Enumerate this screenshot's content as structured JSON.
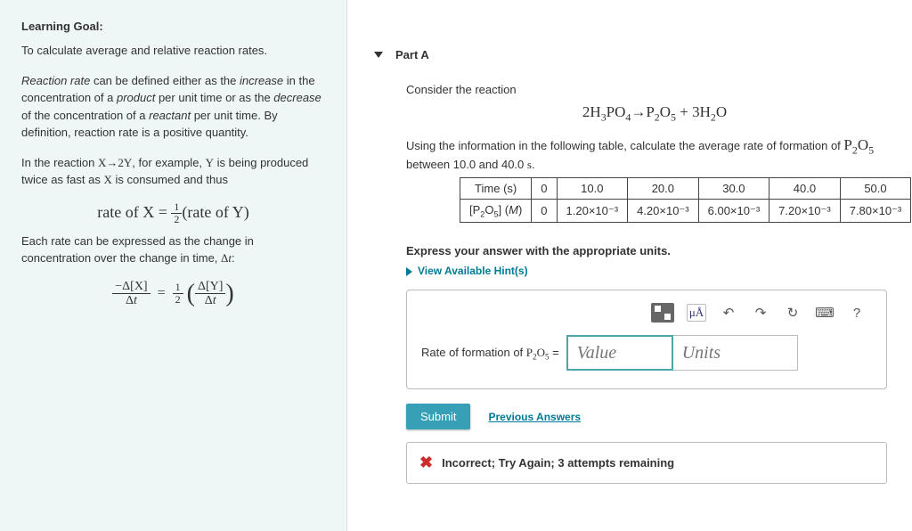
{
  "sidebar": {
    "heading": "Learning Goal:",
    "intro": "To calculate average and relative reaction rates.",
    "para1_a": "Reaction rate",
    "para1_b": " can be defined either as the ",
    "para1_c": "increase",
    "para1_d": " in the concentration of a ",
    "para1_e": "product",
    "para1_f": " per unit time or as the ",
    "para1_g": "decrease",
    "para1_h": " of the concentration of a ",
    "para1_i": "reactant",
    "para1_j": " per unit time. By definition, reaction rate is a positive quantity.",
    "para2_a": "In the reaction ",
    "para2_b": ", for example, ",
    "para2_c": " is being produced twice as fast as ",
    "para2_d": " is consumed and thus",
    "rate_eq_left": "rate of X",
    "rate_eq_right": "(rate of Y)",
    "para3": "Each rate can be expressed as the change in concentration over the change in time, "
  },
  "main": {
    "part_label": "Part A",
    "consider": "Consider the reaction",
    "instr_a": "Using the information in the following table, calculate the average rate of formation of ",
    "instr_b": " between 10.0 and 40.0 ",
    "instr_unit": "s",
    "table": {
      "row1_label": "Time (s)",
      "row1": [
        "0",
        "10.0",
        "20.0",
        "30.0",
        "40.0",
        "50.0"
      ],
      "row2_label_a": "[P",
      "row2_label_b": "O",
      "row2_label_c": "] (M)",
      "row2": [
        "0",
        "1.20×10⁻³",
        "4.20×10⁻³",
        "6.00×10⁻³",
        "7.20×10⁻³",
        "7.80×10⁻³"
      ]
    },
    "prompt": "Express your answer with the appropriate units.",
    "hints": "View Available Hint(s)",
    "mu_label": "μÅ",
    "answer_label_a": "Rate of formation of ",
    "answer_label_b": " = ",
    "value_placeholder": "Value",
    "units_placeholder": "Units",
    "submit": "Submit",
    "previous": "Previous Answers",
    "feedback": "Incorrect; Try Again; 3 attempts remaining"
  }
}
